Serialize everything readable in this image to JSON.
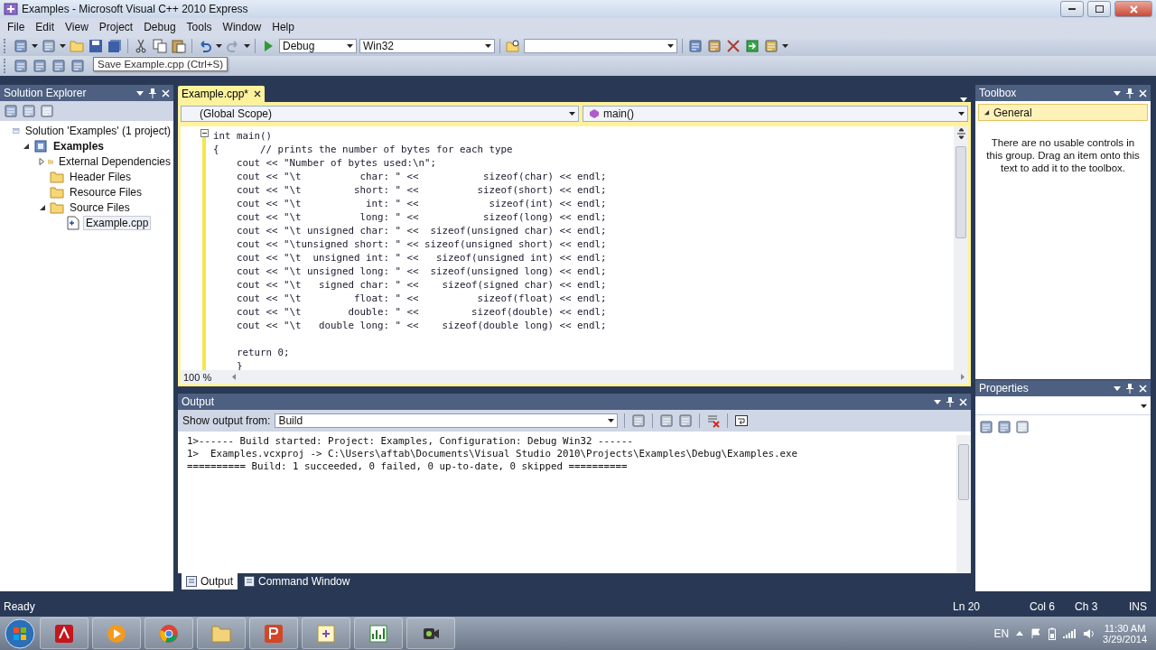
{
  "window": {
    "title": "Examples - Microsoft Visual C++ 2010 Express"
  },
  "menu": [
    "File",
    "Edit",
    "View",
    "Project",
    "Debug",
    "Tools",
    "Window",
    "Help"
  ],
  "toolbar": {
    "configuration": "Debug",
    "platform": "Win32",
    "tooltip": "Save Example.cpp (Ctrl+S)"
  },
  "solution_explorer": {
    "title": "Solution Explorer",
    "tree": [
      {
        "label": "Solution 'Examples' (1 project)",
        "kind": "solution",
        "selected": false,
        "children": [
          {
            "label": "Examples",
            "kind": "project",
            "expanded": true,
            "selected": false,
            "children": [
              {
                "label": "External Dependencies",
                "kind": "folder",
                "expanded": false,
                "selected": false
              },
              {
                "label": "Header Files",
                "kind": "folder",
                "selected": false
              },
              {
                "label": "Resource Files",
                "kind": "folder",
                "selected": false
              },
              {
                "label": "Source Files",
                "kind": "folder",
                "expanded": true,
                "selected": false,
                "children": [
                  {
                    "label": "Example.cpp",
                    "kind": "file",
                    "selected": true
                  }
                ]
              }
            ]
          }
        ]
      }
    ]
  },
  "editor": {
    "tabs": [
      {
        "label": "Example.cpp*",
        "selected": true
      }
    ],
    "scope": "(Global Scope)",
    "member": "main()",
    "zoom": "100 %",
    "blocks": [
      [
        "int main()",
        "{       // prints the number of bytes for each type",
        "    cout << \"Number of bytes used:\\n\";",
        "    cout << \"\\t          char: \" <<           sizeof(char) << endl;",
        "    cout << \"\\t         short: \" <<          sizeof(short) << endl;",
        "    cout << \"\\t           int: \" <<            sizeof(int) << endl;",
        "    cout << \"\\t          long: \" <<           sizeof(long) << endl;",
        "    cout << \"\\t unsigned char: \" <<  sizeof(unsigned char) << endl;",
        "    cout << \"\\tunsigned short: \" << sizeof(unsigned short) << endl;",
        "    cout << \"\\t  unsigned int: \" <<   sizeof(unsigned int) << endl;",
        "    cout << \"\\t unsigned long: \" <<  sizeof(unsigned long) << endl;",
        "    cout << \"\\t   signed char: \" <<    sizeof(signed char) << endl;",
        "    cout << \"\\t         float: \" <<          sizeof(float) << endl;",
        "    cout << \"\\t        double: \" <<         sizeof(double) << endl;",
        "    cout << \"\\t   double long: \" <<    sizeof(double long) << endl;"
      ],
      [
        "    return 0;",
        "    }"
      ]
    ]
  },
  "toolbox": {
    "title": "Toolbox",
    "group": {
      "label": "General",
      "expanded": true
    },
    "message": "There are no usable controls in this group. Drag an item onto this text to add it to the toolbox."
  },
  "properties": {
    "title": "Properties"
  },
  "output": {
    "title": "Output",
    "source_label": "Show output from:",
    "source": "Build",
    "lines": [
      "1>------ Build started: Project: Examples, Configuration: Debug Win32 ------",
      "1>  Examples.vcxproj -> C:\\Users\\aftab\\Documents\\Visual Studio 2010\\Projects\\Examples\\Debug\\Examples.exe",
      "========== Build: 1 succeeded, 0 failed, 0 up-to-date, 0 skipped =========="
    ],
    "tabs": [
      {
        "label": "Output",
        "selected": true
      },
      {
        "label": "Command Window",
        "selected": false
      }
    ]
  },
  "status_bar": {
    "message": "Ready",
    "line": "Ln 20",
    "column": "Col 6",
    "char": "Ch 3",
    "mode": "INS"
  },
  "taskbar": {
    "language": "EN",
    "time": "11:30 AM",
    "date": "3/29/2014"
  }
}
